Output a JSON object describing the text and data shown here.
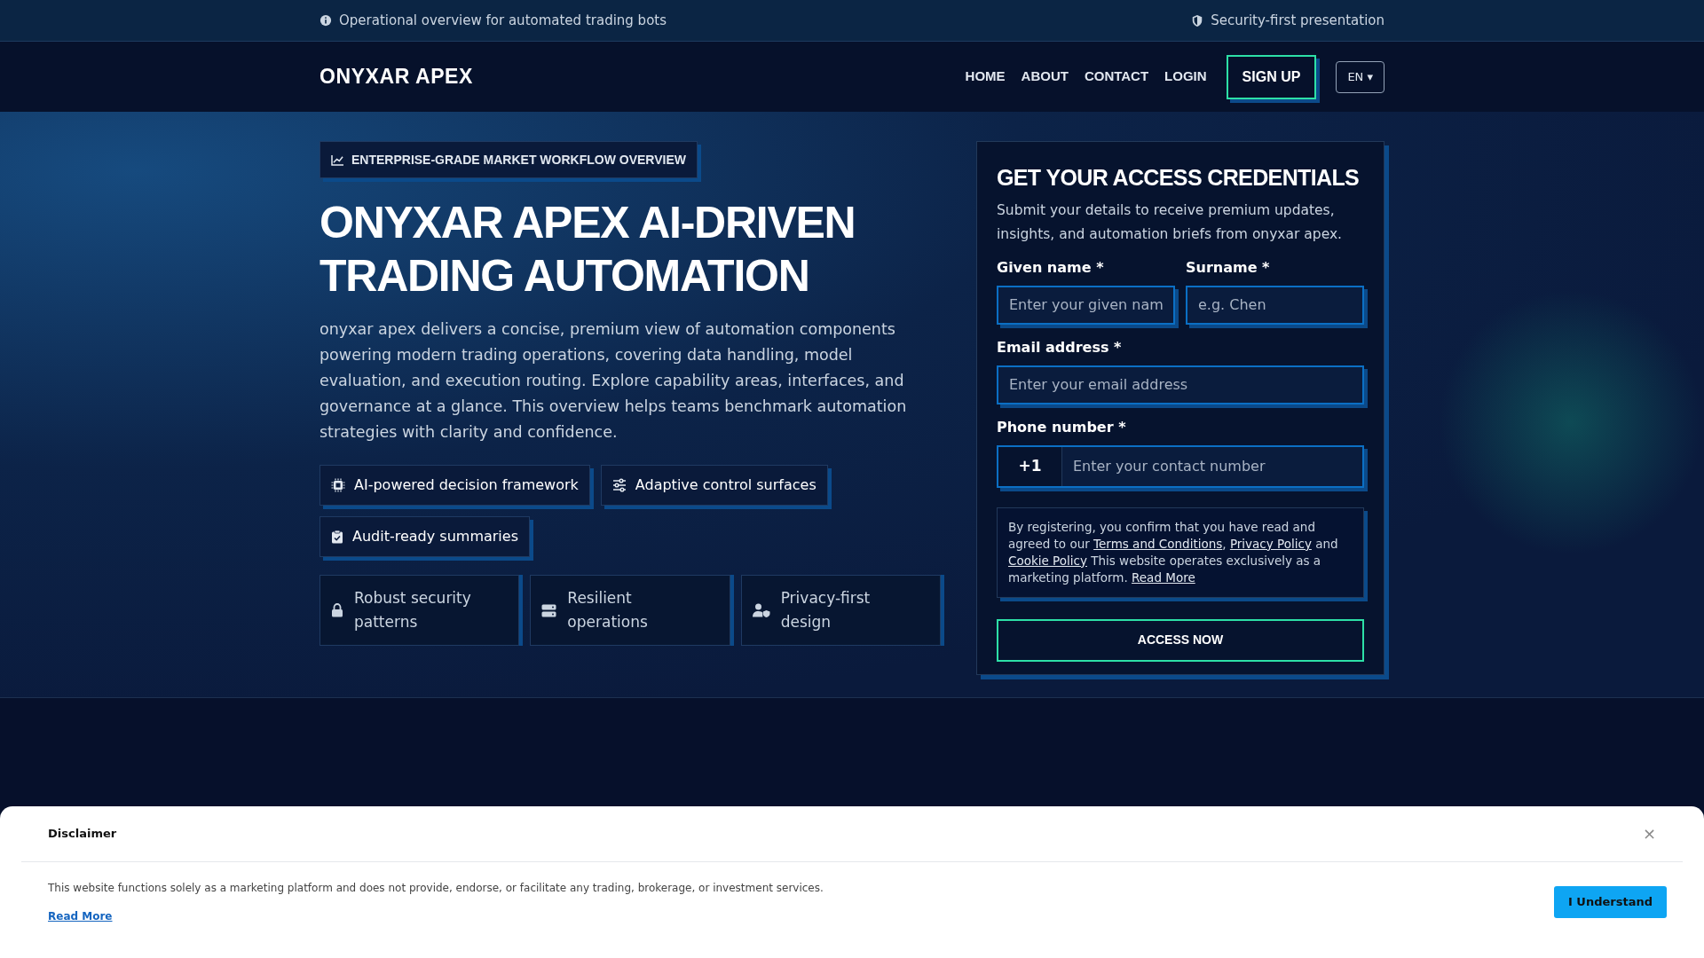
{
  "top_bar": {
    "left_text": "Operational overview for automated trading bots",
    "right_text": "Security-first presentation"
  },
  "nav": {
    "logo": "ONYXAR APEX",
    "links": [
      "HOME",
      "ABOUT",
      "CONTACT",
      "LOGIN"
    ],
    "signup": "SIGN UP",
    "language": "EN ▾"
  },
  "hero": {
    "badge": "ENTERPRISE-GRADE MARKET WORKFLOW OVERVIEW",
    "title": "ONYXAR APEX AI-DRIVEN TRADING AUTOMATION",
    "description": "onyxar apex delivers a concise, premium view of automation components powering modern trading operations, covering data handling, model evaluation, and execution routing. Explore capability areas, interfaces, and governance at a glance. This overview helps teams benchmark automation strategies with clarity and confidence.",
    "tags": [
      "AI-powered decision framework",
      "Adaptive control surfaces",
      "Audit-ready summaries"
    ],
    "features": [
      "Robust security patterns",
      "Resilient operations",
      "Privacy-first design"
    ]
  },
  "form": {
    "title": "GET YOUR ACCESS CREDENTIALS",
    "subtitle": "Submit your details to receive premium updates, insights, and automation briefs from onyxar apex.",
    "name_fields": [
      {
        "label": "Given name *",
        "placeholder": "Enter your given nam"
      },
      {
        "label": "Surname *",
        "placeholder": "e.g. Chen"
      }
    ],
    "email": {
      "label": "Email address *",
      "placeholder": "Enter your email address"
    },
    "phone": {
      "label": "Phone number *",
      "prefix": "+1",
      "placeholder": "Enter your contact number"
    },
    "consent": [
      {
        "kind": "text",
        "text": "By registering, you confirm that you have read and agreed to our "
      },
      {
        "kind": "link",
        "text": "Terms and Conditions"
      },
      {
        "kind": "text",
        "text": ", "
      },
      {
        "kind": "link",
        "text": "Privacy Policy"
      },
      {
        "kind": "text",
        "text": " and "
      },
      {
        "kind": "link",
        "text": "Cookie Policy"
      },
      {
        "kind": "text",
        "text": " This website operates exclusively as a marketing platform. "
      },
      {
        "kind": "link",
        "text": "Read More"
      }
    ],
    "submit": "ACCESS NOW"
  },
  "disclaimer": {
    "title": "Disclaimer",
    "close": "×",
    "text": "This website functions solely as a marketing platform and does not provide, endorse, or facilitate any trading, brokerage, or investment services.",
    "read_more": "Read More",
    "button": "I Understand"
  }
}
